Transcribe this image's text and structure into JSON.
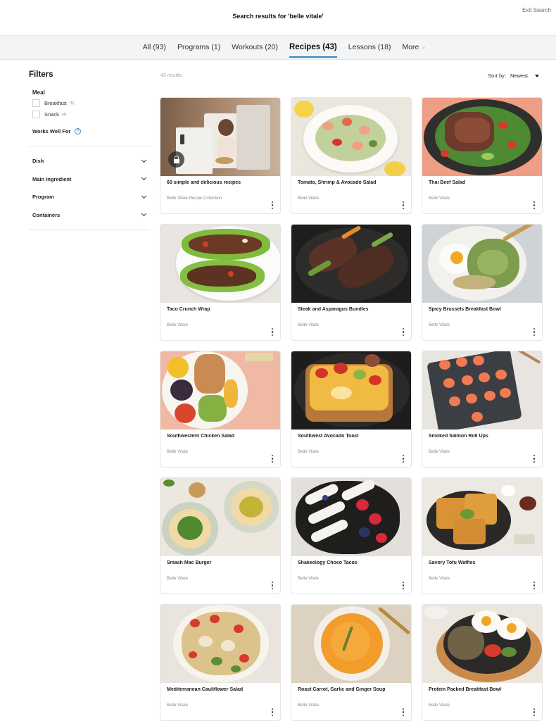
{
  "header": {
    "search_title": "Search results for 'belle vitale'",
    "exit_label": "Exit Search"
  },
  "tabs": [
    {
      "label": "All (93)",
      "active": false
    },
    {
      "label": "Programs (1)",
      "active": false
    },
    {
      "label": "Workouts (20)",
      "active": false
    },
    {
      "label": "Recipes (43)",
      "active": true
    },
    {
      "label": "Lessons (18)",
      "active": false
    },
    {
      "label": "More",
      "active": false
    }
  ],
  "sidebar": {
    "title": "Filters",
    "meal_label": "Meal",
    "meal_options": [
      {
        "label": "Breakfast",
        "count": "(5)"
      },
      {
        "label": "Snack",
        "count": "(4)"
      }
    ],
    "works_well_label": "Works Well For",
    "help_icon": "question-mark-icon",
    "accordions": [
      "Dish",
      "Main Ingredient",
      "Program",
      "Containers"
    ]
  },
  "results": {
    "count_label": "43 results",
    "sort_label": "Sort by:",
    "sort_value": "Newest"
  },
  "colors": {
    "accent": "#2a86c9",
    "tab_bar_bg": "#f3f4f6"
  },
  "cards": [
    {
      "title": "60 simple and delicious recipes",
      "subtitle": "Belle Vitale Recipe Collection",
      "locked": true
    },
    {
      "title": "Tomato, Shrimp & Avocado Salad",
      "subtitle": "Belle Vitale"
    },
    {
      "title": "Thai Beef Salad",
      "subtitle": "Belle Vitale"
    },
    {
      "title": "Taco Crunch Wrap",
      "subtitle": "Belle Vitale"
    },
    {
      "title": "Steak and Asparagus Bundles",
      "subtitle": "Belle Vitale"
    },
    {
      "title": "Spicy Brussels Breakfast Bowl",
      "subtitle": "Belle Vitale"
    },
    {
      "title": "Southwestern Chicken Salad",
      "subtitle": "Belle Vitale"
    },
    {
      "title": "Southwest Avocado Toast",
      "subtitle": "Belle Vitale"
    },
    {
      "title": "Smoked Salmon Roll Ups",
      "subtitle": "Belle Vitale"
    },
    {
      "title": "Smash Mac Burger",
      "subtitle": "Belle Vitale"
    },
    {
      "title": "Shakeology Choco Tacos",
      "subtitle": "Belle Vitale"
    },
    {
      "title": "Savory Tofu Waffles",
      "subtitle": "Belle Vitale"
    },
    {
      "title": "Mediterranean Cauliflower Salad",
      "subtitle": "Belle Vitale"
    },
    {
      "title": "Roast Carrot, Garlic and Ginger Soup",
      "subtitle": "Belle Vitale"
    },
    {
      "title": "Protein Packed Breakfast Bowl",
      "subtitle": "Belle Vitale"
    }
  ]
}
